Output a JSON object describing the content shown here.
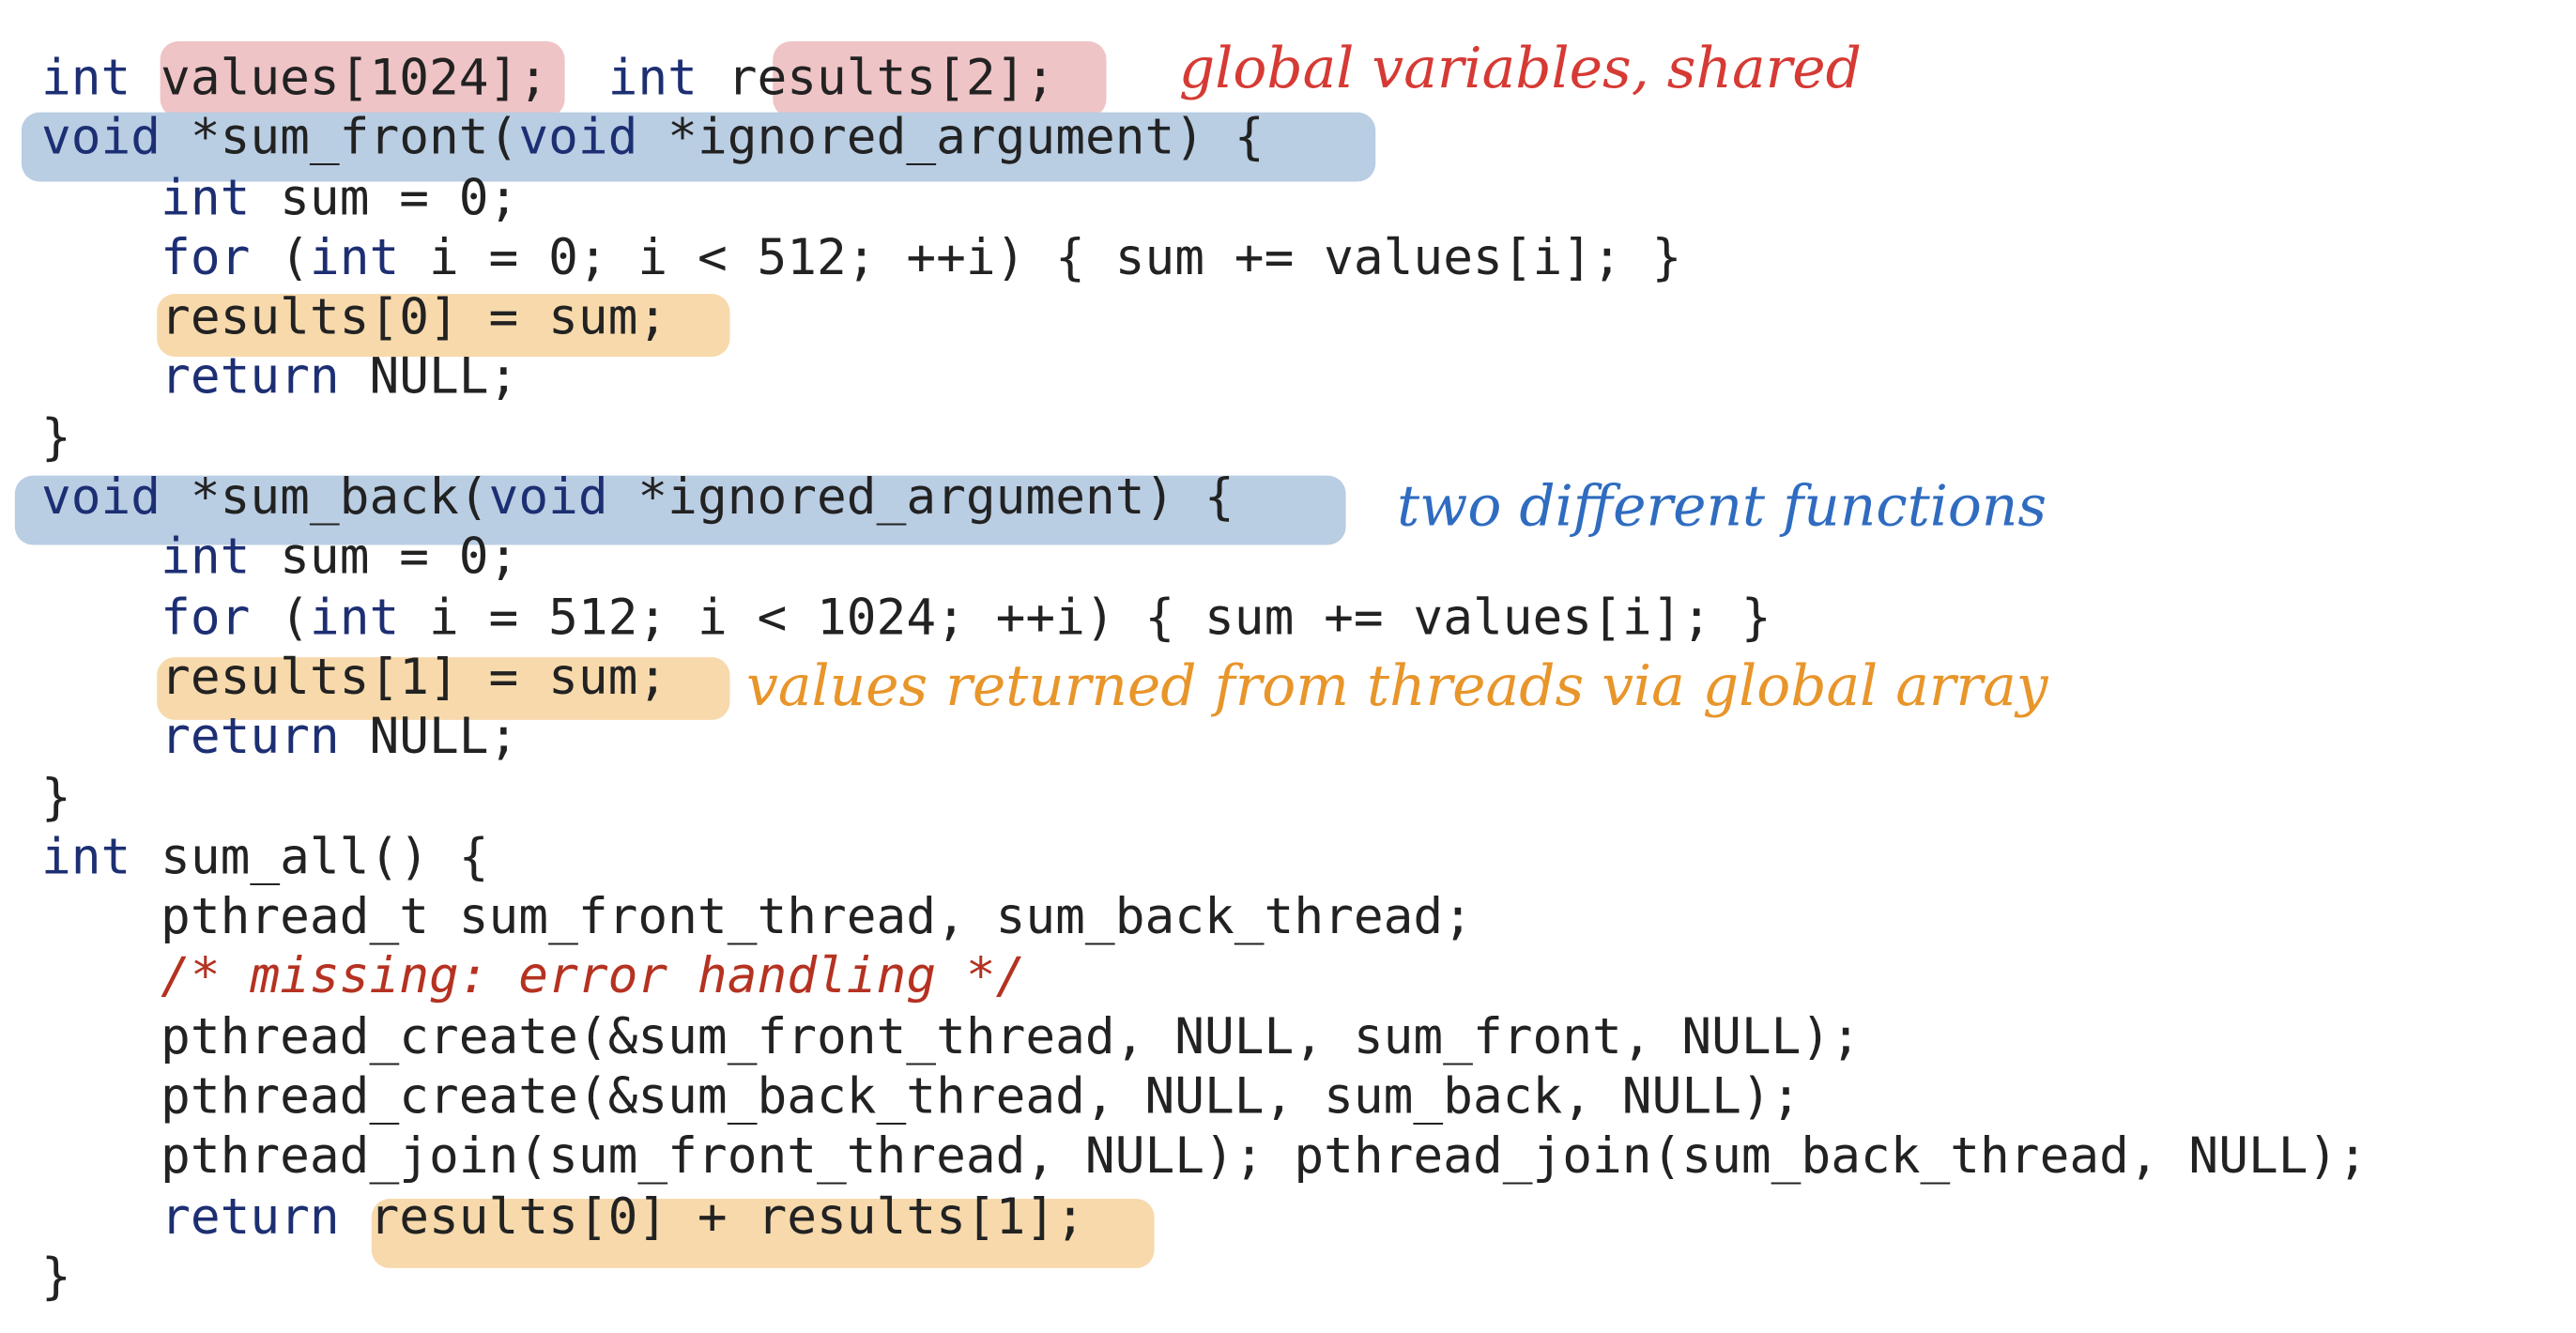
{
  "code_lines": [
    [
      {
        "t": "int",
        "k": "kw"
      },
      {
        "t": " values[1024]; "
      },
      {
        "t": " int",
        "k": "kw"
      },
      {
        "t": " results[2];"
      }
    ],
    [
      {
        "t": "void",
        "k": "kw"
      },
      {
        "t": " *sum_front("
      },
      {
        "t": "void",
        "k": "kw"
      },
      {
        "t": " *ignored_argument) {"
      }
    ],
    [
      {
        "t": "    "
      },
      {
        "t": "int",
        "k": "kw"
      },
      {
        "t": " sum = 0;"
      }
    ],
    [
      {
        "t": "    "
      },
      {
        "t": "for",
        "k": "kw"
      },
      {
        "t": " ("
      },
      {
        "t": "int",
        "k": "kw"
      },
      {
        "t": " i = 0; i < 512; ++i) { sum += values[i]; }"
      }
    ],
    [
      {
        "t": "    results[0] = sum;"
      }
    ],
    [
      {
        "t": "    "
      },
      {
        "t": "return",
        "k": "kw"
      },
      {
        "t": " NULL;"
      }
    ],
    [
      {
        "t": "}"
      }
    ],
    [
      {
        "t": "void",
        "k": "kw"
      },
      {
        "t": " *sum_back("
      },
      {
        "t": "void",
        "k": "kw"
      },
      {
        "t": " *ignored_argument) {"
      }
    ],
    [
      {
        "t": "    "
      },
      {
        "t": "int",
        "k": "kw"
      },
      {
        "t": " sum = 0;"
      }
    ],
    [
      {
        "t": "    "
      },
      {
        "t": "for",
        "k": "kw"
      },
      {
        "t": " ("
      },
      {
        "t": "int",
        "k": "kw"
      },
      {
        "t": " i = 512; i < 1024; ++i) { sum += values[i]; }"
      }
    ],
    [
      {
        "t": "    results[1] = sum;"
      }
    ],
    [
      {
        "t": "    "
      },
      {
        "t": "return",
        "k": "kw"
      },
      {
        "t": " NULL;"
      }
    ],
    [
      {
        "t": "}"
      }
    ],
    [
      {
        "t": "int",
        "k": "kw"
      },
      {
        "t": " sum_all() {"
      }
    ],
    [
      {
        "t": "    pthread_t sum_front_thread, sum_back_thread;"
      }
    ],
    [
      {
        "t": "    "
      },
      {
        "t": "/* missing: error handling */",
        "k": "cmt"
      }
    ],
    [
      {
        "t": "    pthread_create(&sum_front_thread, NULL, sum_front, NULL);"
      }
    ],
    [
      {
        "t": "    pthread_create(&sum_back_thread, NULL, sum_back, NULL);"
      }
    ],
    [
      {
        "t": "    pthread_join(sum_front_thread, NULL); pthread_join(sum_back_thread, NULL);"
      }
    ],
    [
      {
        "t": "    "
      },
      {
        "t": "return",
        "k": "kw"
      },
      {
        "t": " results[0] + results[1];"
      }
    ],
    [
      {
        "t": "}"
      }
    ]
  ],
  "annotations": {
    "global": "global variables, shared",
    "functions": "two different functions",
    "returned": "values returned from threads via global array"
  },
  "colors": {
    "highlight_red": "#efc4c6",
    "highlight_blue": "#b9cde3",
    "highlight_orange": "#f7d9ab",
    "note_red": "#d63a34",
    "note_blue": "#2f6cc0",
    "note_orange": "#e8952a",
    "keyword": "#1d2f73",
    "comment": "#b53221"
  }
}
